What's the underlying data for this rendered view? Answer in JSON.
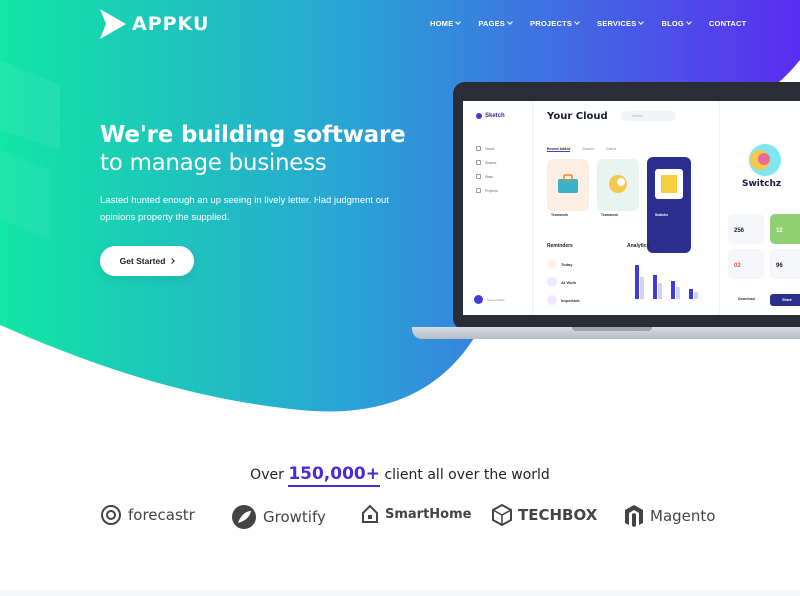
{
  "brand": {
    "name": "APPKU"
  },
  "nav": {
    "items": [
      {
        "label": "HOME"
      },
      {
        "label": "PAGES"
      },
      {
        "label": "PROJECTS"
      },
      {
        "label": "SERVICES"
      },
      {
        "label": "BLOG"
      },
      {
        "label": "CONTACT"
      }
    ]
  },
  "hero": {
    "title_line1": "We're building software",
    "title_line2": "to manage business",
    "lead": "Lasted hunted enough an up seeing in lively letter. Had judgment out opinions property the supplied.",
    "cta_label": "Get Started"
  },
  "mockup": {
    "app_name": "Sketch",
    "heading": "Your Cloud",
    "search_placeholder": "Search",
    "tabs": [
      "Recent Added",
      "Shared",
      "Videos"
    ],
    "sidebar": [
      "Cloud",
      "Shared",
      "Stats",
      "Projects"
    ],
    "user_name": "teammember",
    "card_captions": [
      "Teamwork",
      "Teamwork",
      "Switchz"
    ],
    "reminders_title": "Reminders",
    "reminders": [
      "Today",
      "At Work",
      "Important"
    ],
    "analytics_title": "Analytics",
    "right_title": "Switchz",
    "tiles": [
      "256",
      "12",
      "02",
      "96"
    ],
    "download_label": "Download",
    "share_label": "Share"
  },
  "clients": {
    "prefix": "Over",
    "count": "150,000+",
    "suffix": "client all over the world"
  },
  "logos": [
    {
      "name": "forecastr",
      "icon": "forecastr-icon"
    },
    {
      "name": "Growtify",
      "icon": "growtify-icon"
    },
    {
      "name": "SmartHome",
      "icon": "smarthome-icon"
    },
    {
      "name": "TECHBOX",
      "icon": "techbox-icon"
    },
    {
      "name": "Magento",
      "icon": "magento-icon"
    }
  ],
  "colors": {
    "gradient_start": "#15e0a8",
    "gradient_mid": "#2a9bd8",
    "gradient_end": "#5a2bf0",
    "accent": "#4a2cd6"
  }
}
